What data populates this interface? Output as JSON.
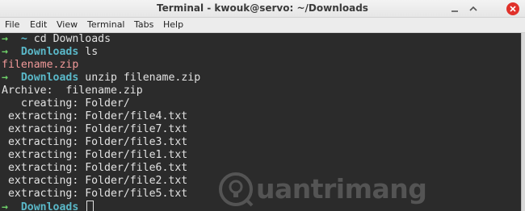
{
  "window": {
    "title": "Terminal - kwouk@servo: ~/Downloads",
    "buttons": [
      "minimize-icon",
      "maximize-icon",
      "close-icon"
    ]
  },
  "menubar": {
    "items": [
      "File",
      "Edit",
      "View",
      "Terminal",
      "Tabs",
      "Help"
    ]
  },
  "terminal": {
    "lines": [
      {
        "prompt": "→",
        "dir": "~",
        "cmd": "cd Downloads"
      },
      {
        "prompt": "→",
        "dir": "Downloads",
        "cmd": "ls"
      },
      {
        "text": "filename.zip"
      },
      {
        "prompt": "→",
        "dir": "Downloads",
        "cmd": "unzip filename.zip"
      },
      {
        "text": "Archive:  filename.zip"
      },
      {
        "text": "   creating: Folder/"
      },
      {
        "text": " extracting: Folder/file4.txt"
      },
      {
        "text": " extracting: Folder/file7.txt"
      },
      {
        "text": " extracting: Folder/file3.txt"
      },
      {
        "text": " extracting: Folder/file1.txt"
      },
      {
        "text": " extracting: Folder/file6.txt"
      },
      {
        "text": " extracting: Folder/file2.txt"
      },
      {
        "text": " extracting: Folder/file5.txt"
      },
      {
        "prompt": "→",
        "dir": "Downloads",
        "cmd": ""
      }
    ]
  },
  "watermark": {
    "text": "uantrimang"
  },
  "colors": {
    "background": "#2b2b2b",
    "prompt_arrow": "#6fd36a",
    "prompt_dir": "#5ab8c8",
    "archive_file": "#f09999",
    "text": "#e2e2e2"
  }
}
